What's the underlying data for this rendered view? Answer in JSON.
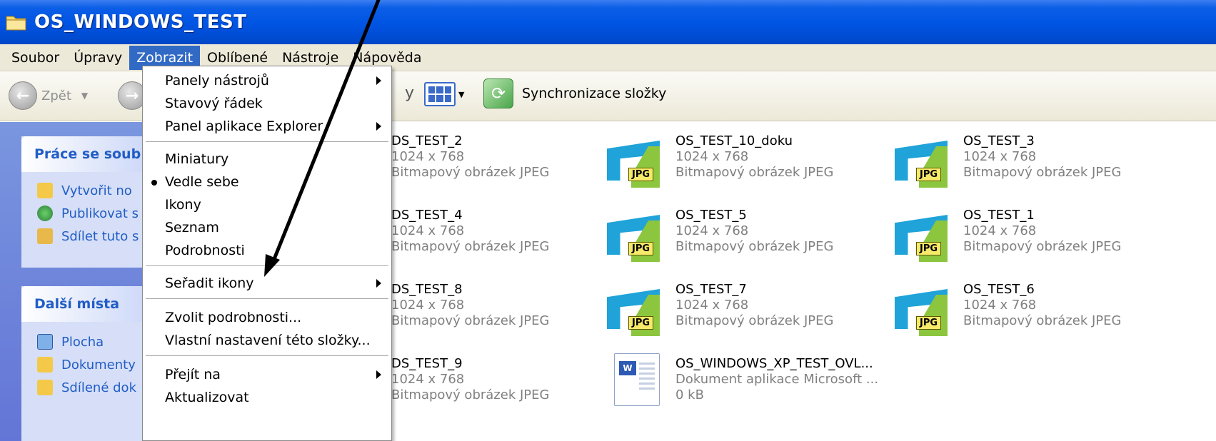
{
  "window": {
    "title": "OS_WINDOWS_TEST"
  },
  "menubar": {
    "items": [
      {
        "label": "Soubor"
      },
      {
        "label": "Úpravy"
      },
      {
        "label": "Zobrazit"
      },
      {
        "label": "Oblíbené"
      },
      {
        "label": "Nástroje"
      },
      {
        "label": "Nápověda"
      }
    ],
    "active": "Zobrazit"
  },
  "toolbar": {
    "back_label": "Zpět",
    "partial_label": "y",
    "sync_label": "Synchronizace složky"
  },
  "taskpane": {
    "file_tasks": {
      "header": "Práce se soub",
      "links": [
        {
          "label": "Vytvořit no"
        },
        {
          "label": "Publikovat s"
        },
        {
          "label": "Sdílet tuto s"
        }
      ]
    },
    "other_places": {
      "header": "Další místa",
      "links": [
        {
          "label": "Plocha"
        },
        {
          "label": "Dokumenty"
        },
        {
          "label": "Sdílené dok"
        }
      ]
    }
  },
  "view_menu": {
    "items": [
      {
        "label": "Panely nástrojů",
        "submenu": true
      },
      {
        "label": "Stavový řádek"
      },
      {
        "label": "Panel aplikace Explorer",
        "submenu": true
      },
      {
        "label": "Miniatury"
      },
      {
        "label": "Vedle sebe",
        "selected": true
      },
      {
        "label": "Ikony"
      },
      {
        "label": "Seznam"
      },
      {
        "label": "Podrobnosti"
      },
      {
        "label": "Seřadit ikony",
        "submenu": true
      },
      {
        "label": "Zvolit podrobnosti..."
      },
      {
        "label": "Vlastní nastavení této složky..."
      },
      {
        "label": "Přejít na",
        "submenu": true
      },
      {
        "label": "Aktualizovat"
      }
    ]
  },
  "files": [
    {
      "name": "DS_TEST_2",
      "line2": "1024 x 768",
      "line3": "Bitmapový obrázek JPEG"
    },
    {
      "name": "OS_TEST_10_doku",
      "line2": "1024 x 768",
      "line3": "Bitmapový obrázek JPEG"
    },
    {
      "name": "OS_TEST_3",
      "line2": "1024 x 768",
      "line3": "Bitmapový obrázek JPEG"
    },
    {
      "name": "DS_TEST_4",
      "line2": "1024 x 768",
      "line3": "Bitmapový obrázek JPEG"
    },
    {
      "name": "OS_TEST_5",
      "line2": "1024 x 768",
      "line3": "Bitmapový obrázek JPEG"
    },
    {
      "name": "OS_TEST_1",
      "line2": "1024 x 768",
      "line3": "Bitmapový obrázek JPEG"
    },
    {
      "name": "DS_TEST_8",
      "line2": "1024 x 768",
      "line3": "Bitmapový obrázek JPEG"
    },
    {
      "name": "OS_TEST_7",
      "line2": "1024 x 768",
      "line3": "Bitmapový obrázek JPEG"
    },
    {
      "name": "OS_TEST_6",
      "line2": "1024 x 768",
      "line3": "Bitmapový obrázek JPEG"
    },
    {
      "name": "DS_TEST_9",
      "line2": "1024 x 768",
      "line3": "Bitmapový obrázek JPEG"
    },
    {
      "name": "OS_WINDOWS_XP_TEST_OVL...",
      "line2": "Dokument aplikace Microsoft ...",
      "line3": "0 kB"
    }
  ],
  "icons": {
    "jpg_tag": "JPG",
    "word_tag": "W"
  },
  "colors": {
    "titlebar": "#0054e3",
    "menu_active": "#316ac5",
    "taskpane": "#6375d6",
    "link": "#215dc6"
  }
}
